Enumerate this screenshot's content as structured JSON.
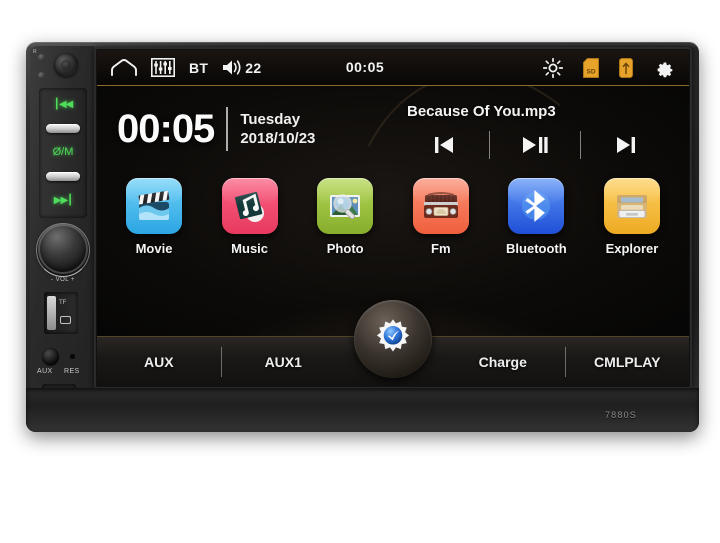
{
  "device": {
    "model_label": "7880S",
    "left_panel": {
      "led_r_label": "R",
      "led_b_label": "",
      "prev_glyph": "┃◀◀",
      "power_mode_label": "Ø/M",
      "next_glyph": "▶▶┃",
      "volume_label": "- VOL +",
      "tf_label": "TF",
      "aux_label": "AUX",
      "res_label": "RES"
    }
  },
  "status_bar": {
    "home_icon": "home-icon",
    "eq_icon": "equalizer-icon",
    "bt_label": "BT",
    "speaker_icon": "speaker-icon",
    "volume_value": "22",
    "clock": "00:05",
    "brightness_icon": "brightness-icon",
    "sd_icon": "sd-card-icon",
    "sd_icon_text": "SD",
    "usb_icon": "usb-icon",
    "settings_icon": "gear-icon"
  },
  "clock_widget": {
    "time": "00:05",
    "weekday": "Tuesday",
    "date": "2018/10/23"
  },
  "player": {
    "track_title": "Because Of You.mp3",
    "prev_icon": "previous-track-icon",
    "play_pause_icon": "play-pause-icon",
    "next_icon": "next-track-icon"
  },
  "apps": [
    {
      "label": "Movie",
      "icon": "movie-clapperboard-icon",
      "color": "#49b8ef"
    },
    {
      "label": "Music",
      "icon": "music-note-icon",
      "color": "#f0486b"
    },
    {
      "label": "Photo",
      "icon": "photo-magnifier-icon",
      "color": "#9cc23d"
    },
    {
      "label": "Fm",
      "icon": "radio-icon",
      "color": "#f0765a"
    },
    {
      "label": "Bluetooth",
      "icon": "bluetooth-icon",
      "color": "#2f6df0"
    },
    {
      "label": "Explorer",
      "icon": "file-explorer-icon",
      "color": "#f5b43a"
    }
  ],
  "tabbar": {
    "items": [
      "AUX",
      "AUX1",
      "Charge",
      "CMLPLAY"
    ],
    "center_button_icon": "settings-gear-icon"
  },
  "colors": {
    "accent_gold": "#8a6a2e",
    "screen_bg": "#0d0b09",
    "bezel": "#2b2b2b"
  }
}
